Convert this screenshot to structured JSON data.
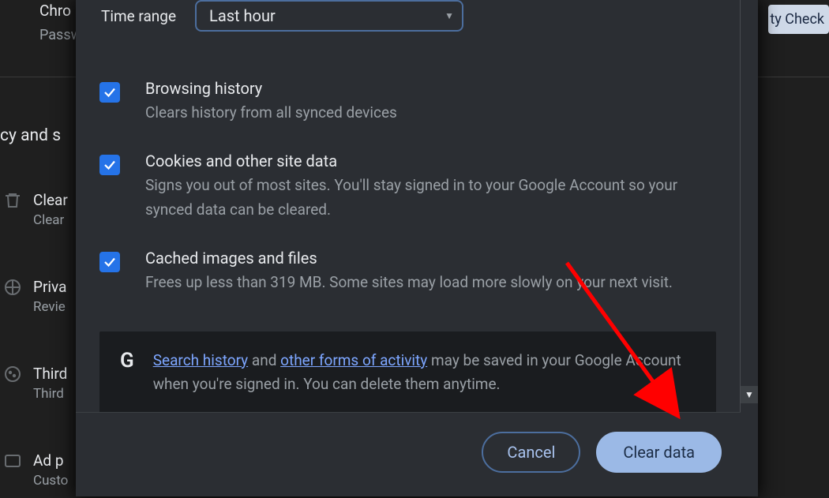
{
  "background": {
    "chrome_label": "Chro",
    "password_label": "Passw",
    "section_heading": "cy and s",
    "safety_check_chip": "ty Check",
    "items": [
      {
        "title": "Clear",
        "sub": "Clear"
      },
      {
        "title": "Priva",
        "sub": "Revie"
      },
      {
        "title": "Third",
        "sub": "Third"
      },
      {
        "title": "Ad p",
        "sub": "Custo"
      }
    ]
  },
  "dialog": {
    "time_range_label": "Time range",
    "time_range_value": "Last hour",
    "options": [
      {
        "checked": true,
        "title": "Browsing history",
        "sub": "Clears history from all synced devices"
      },
      {
        "checked": true,
        "title": "Cookies and other site data",
        "sub": "Signs you out of most sites. You'll stay signed in to your Google Account so your synced data can be cleared."
      },
      {
        "checked": true,
        "title": "Cached images and files",
        "sub": "Frees up less than 319 MB. Some sites may load more slowly on your next visit."
      }
    ],
    "info": {
      "link1": "Search history",
      "mid1": " and ",
      "link2": "other forms of activity",
      "rest": " may be saved in your Google Account when you're signed in. You can delete them anytime."
    },
    "buttons": {
      "cancel": "Cancel",
      "clear": "Clear data"
    }
  }
}
